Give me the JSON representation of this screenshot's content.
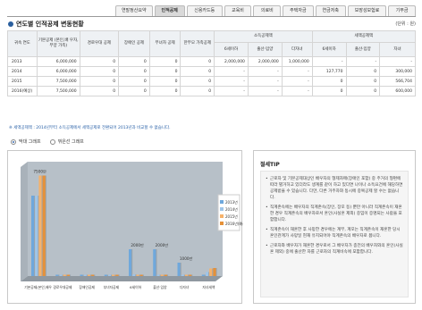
{
  "tabs": [
    {
      "label": "연말정산요약",
      "active": false
    },
    {
      "label": "인적공제",
      "active": true
    },
    {
      "label": "신용카드등",
      "active": false
    },
    {
      "label": "교육비",
      "active": false
    },
    {
      "label": "의료비",
      "active": false
    },
    {
      "label": "주택자금",
      "active": false
    },
    {
      "label": "연금저축",
      "active": false
    },
    {
      "label": "보장성보험료",
      "active": false
    },
    {
      "label": "기부금",
      "active": false
    }
  ],
  "title": "연도별 인적공제 변동현황",
  "unit": "(단위 : 원)",
  "table": {
    "headers": {
      "year": "귀속 연도",
      "basic": "기본공제 (본인,배 우자,부양 가족)",
      "elderly": "경로우대 공제",
      "disabled": "장애인 공제",
      "female": "부녀자 공제",
      "single_parent": "한부모 가족공제",
      "income_group": "소득공제액",
      "tax_group": "세액공제액",
      "under6": "6세이하",
      "birth": "출산·입양",
      "multi": "다자녀",
      "under6_t": "6세이하",
      "birth_t": "출산·입양",
      "child_t": "자녀"
    },
    "rows": [
      [
        "2013",
        "6,000,000",
        "0",
        "0",
        "0",
        "0",
        "2,000,000",
        "2,000,000",
        "1,000,000",
        "-",
        "-",
        "-"
      ],
      [
        "2014",
        "6,000,000",
        "0",
        "0",
        "0",
        "0",
        "-",
        "-",
        "-",
        "127,770",
        "0",
        "300,000"
      ],
      [
        "2015",
        "7,500,000",
        "0",
        "0",
        "0",
        "0",
        "-",
        "-",
        "-",
        "0",
        "0",
        "566,704"
      ],
      [
        "2016(예상)",
        "7,500,000",
        "0",
        "0",
        "0",
        "0",
        "-",
        "-",
        "-",
        "0",
        "0",
        "600,000"
      ]
    ]
  },
  "note": "※ 세액공제액 : 2014년부터 소득공제에서 세액공제로 전환되어 2013년과 비교할 수 없습니다.",
  "radios": [
    {
      "label": "막대 그래프",
      "selected": true
    },
    {
      "label": "꺾은선 그래프",
      "selected": false
    }
  ],
  "chart_data": {
    "type": "bar",
    "categories": [
      "기본공제(본인,배우자,부양가족)",
      "경로우대공제",
      "장애인공제",
      "부녀자공제",
      "6세이하",
      "출산·입양",
      "다자녀",
      "자녀세액"
    ],
    "series": [
      {
        "name": "2013년",
        "values": [
          6000000,
          0,
          0,
          0,
          2000000,
          2000000,
          1000000,
          0
        ]
      },
      {
        "name": "2014년",
        "values": [
          6000000,
          0,
          0,
          0,
          127770,
          0,
          0,
          300000
        ]
      },
      {
        "name": "2015년",
        "values": [
          7500000,
          0,
          0,
          0,
          0,
          0,
          0,
          566704
        ]
      },
      {
        "name": "2016년(예상)",
        "values": [
          7500000,
          0,
          0,
          0,
          0,
          0,
          0,
          600000
        ]
      }
    ],
    "data_labels": [
      "7500만",
      "2000만",
      "2000만",
      "1000만"
    ],
    "colors": [
      "#6fa8dc",
      "#9fc5e8",
      "#f6b26b",
      "#e69138"
    ],
    "legend": [
      "2013년",
      "2014년",
      "2015년",
      "2016년(예상)"
    ],
    "legend_position": "right"
  },
  "tip": {
    "title": "절세TIP",
    "items": [
      "근로자 및 기본공제대상인 배우자의 형제자매(장애인 포함) 중 주거의 형편에 따라 별거하고 있더라도 생계를 같이 하고 있다면 나이나 소득요건에 해당하면 공제받을 수 있습니다. 다만, 다른 거주자와 동시에 중복공제 할 수는 없습니다.",
      "직계존속에는 배우자의 직계존속(장인, 장모 등) 뿐만 아니라 직계존속이 재혼한 경우 직계존속의 배우자로서 혼인(사실혼 제외) 중임이 증명되는 사람을 포함합니다.",
      "직계존속이 재혼한 후 사망한 경우에는 계부, 계모는 직계존속이 재혼한 당시 혼인관계가 사망일 현재 유지되어야 직계존속의 배우자로 봅니다.",
      "근로자와 배우자가 재혼한 경우로서 그 배우자가 종전의 배우자와의 혼인(사실혼 제외) 중에 출산한 자를 근로자의 직계비속에 포함합니다."
    ]
  }
}
